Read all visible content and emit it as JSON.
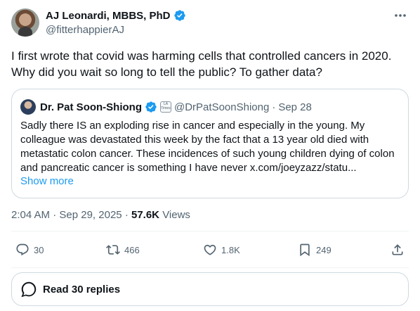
{
  "author": {
    "display_name": "AJ Leonardi, MBBS, PhD",
    "handle": "@fitterhappierAJ",
    "verified_color": "#1d9bf0"
  },
  "tweet": {
    "text": "I first wrote that covid was harming cells that controlled cancers in 2020. Why did you wait so long to tell the public? To gather data?"
  },
  "quote": {
    "display_name": "Dr. Pat Soon-Shiong",
    "affiliation_badge_text": "The Los Angeles Times",
    "handle": "@DrPatSoonShiong",
    "separator": "·",
    "date": "Sep 28",
    "text": "Sadly there IS an exploding rise in cancer and especially in the young. My colleague was devastated this week by the fact that a 13 year old died with metastatic colon cancer. These incidences of such young children dying of colon and pancreatic cancer is something I have never x.com/joeyzazz/statu...",
    "show_more": "Show more"
  },
  "meta": {
    "time": "2:04 AM",
    "separator1": "·",
    "date": "Sep 29, 2025",
    "separator2": "·",
    "views_count": "57.6K",
    "views_label": "Views"
  },
  "actions": {
    "replies": "30",
    "reposts": "466",
    "likes": "1.8K",
    "bookmarks": "249"
  },
  "read_replies": {
    "label": "Read 30 replies"
  },
  "colors": {
    "text": "#0f1419",
    "secondary": "#536471",
    "link": "#1d9bf0",
    "border": "#cfd9de"
  }
}
